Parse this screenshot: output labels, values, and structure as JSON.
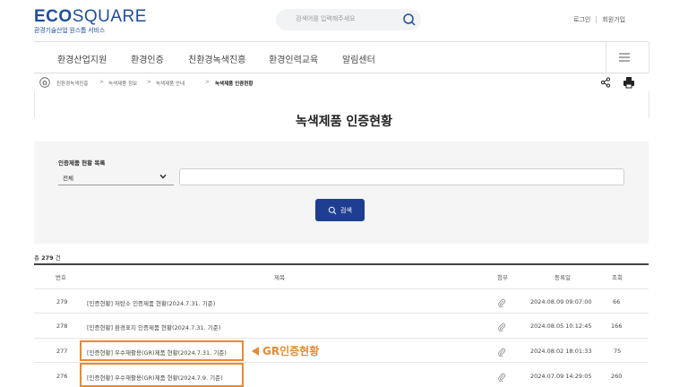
{
  "header": {
    "logo_bold": "ECO",
    "logo_light": "SQUARE",
    "logo_sub": "환경기술산업 원스톱 서비스",
    "search_placeholder": "검색어를 입력해주세요",
    "login": "로그인",
    "signup": "회원가입"
  },
  "nav": {
    "items": [
      "환경산업지원",
      "환경인증",
      "친환경녹색진흥",
      "환경인력교육",
      "알림센터"
    ]
  },
  "breadcrumb": {
    "items": [
      "친환경녹색진흥",
      "녹색제품 정보",
      "녹색제품 안내",
      "녹색제품 인증현황"
    ],
    "separator": ">"
  },
  "page_title": "녹색제품 인증현황",
  "search_panel": {
    "label": "인증제품 현황 목록",
    "select_value": "전체",
    "keyword_value": "",
    "button_label": "검색"
  },
  "total": {
    "prefix": "총",
    "count": "279",
    "suffix": "건"
  },
  "table": {
    "headers": {
      "no": "번호",
      "title": "제목",
      "attach": "첨부",
      "date": "등록일",
      "views": "조회"
    },
    "rows": [
      {
        "no": "279",
        "title": "[인증현황] 저탄소 인증제품 현황(2024.7.31. 기준)",
        "date": "2024.08.09 09:07:00",
        "views": "66"
      },
      {
        "no": "278",
        "title": "[인증현황] 환경표지 인증제품 현황(2024.7.31. 기준)",
        "date": "2024.08.05 10:12:45",
        "views": "166"
      },
      {
        "no": "277",
        "title": "[인증현황] 우수재활용(GR)제품 현황(2024.7.31. 기준)",
        "date": "2024.08.02 18:01:33",
        "views": "75"
      },
      {
        "no": "276",
        "title": "[인증현황] 우수재활용(GR)제품 현황(2024.7.9. 기준)",
        "date": "2024.07.09 14:29:05",
        "views": "260"
      }
    ]
  },
  "annotation": {
    "label": "GR인증현황",
    "color": "#e88a33"
  },
  "colors": {
    "brand": "#1f4e9c",
    "button": "#1e3f91"
  }
}
